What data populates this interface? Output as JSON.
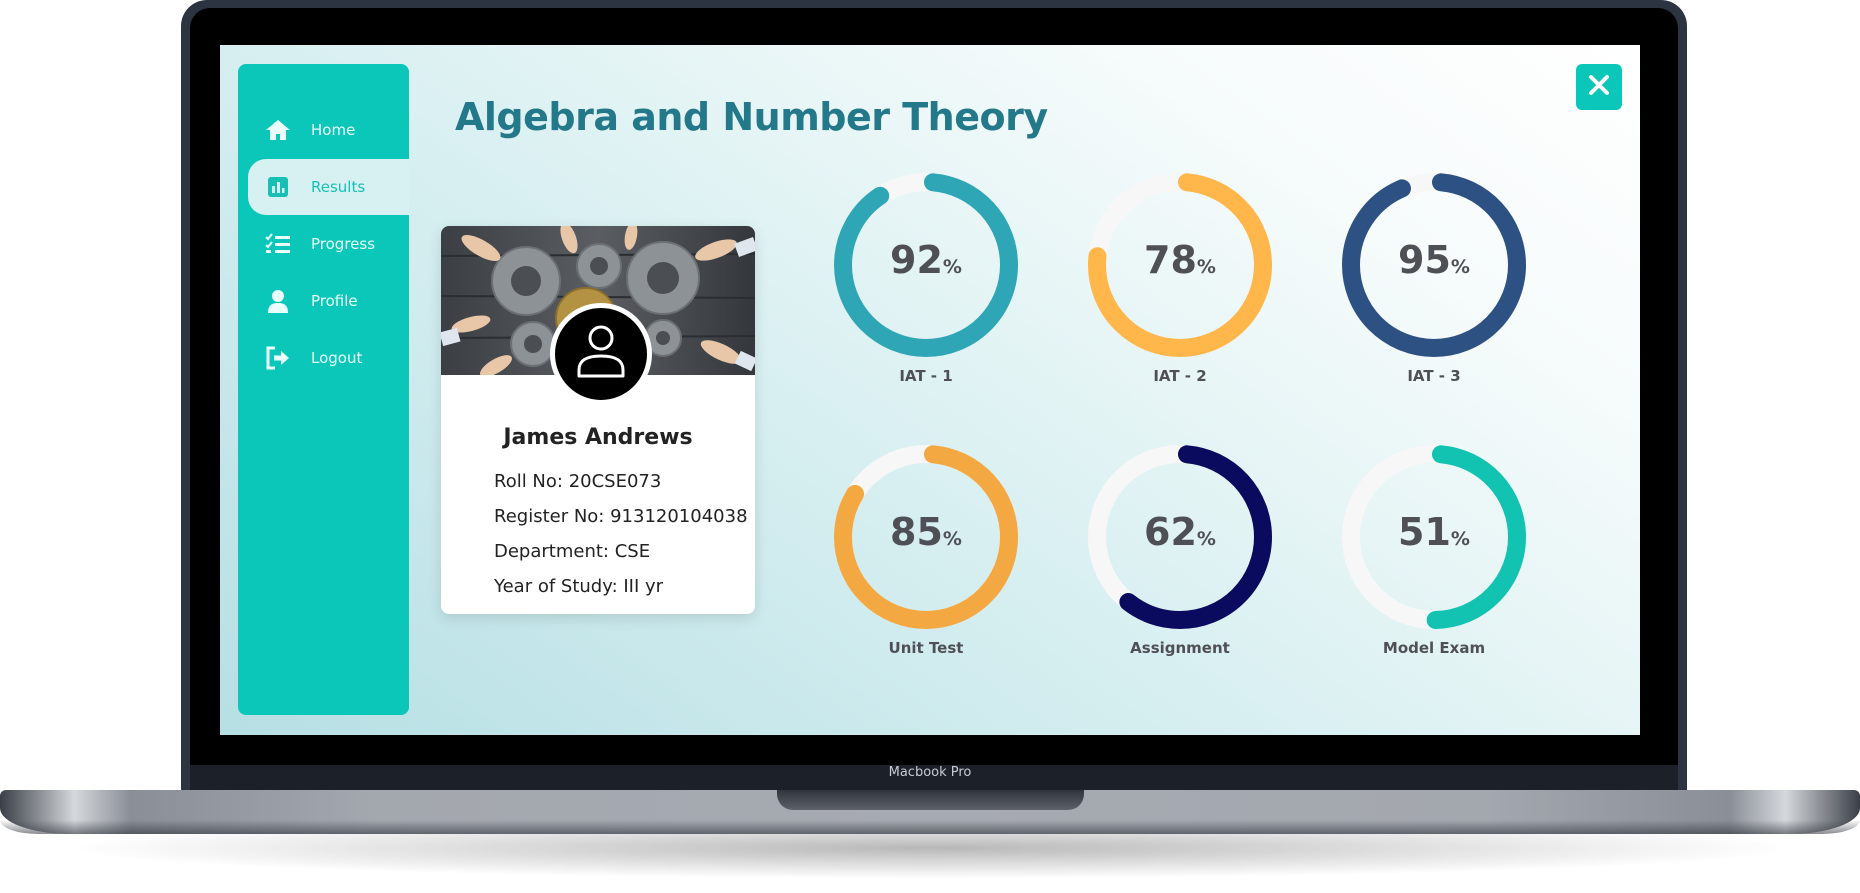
{
  "device": {
    "brand": "Macbook Pro"
  },
  "sidebar": {
    "items": [
      {
        "label": "Home",
        "icon": "home-icon"
      },
      {
        "label": "Results",
        "icon": "bar-chart-icon",
        "active": true
      },
      {
        "label": "Progress",
        "icon": "checklist-icon"
      },
      {
        "label": "Profile",
        "icon": "user-icon"
      },
      {
        "label": "Logout",
        "icon": "logout-icon"
      }
    ]
  },
  "page": {
    "title": "Algebra and Number Theory"
  },
  "profile": {
    "name": "James Andrews",
    "roll": "Roll No: 20CSE073",
    "register": "Register No: 913120104038",
    "department": "Department: CSE",
    "year": "Year of Study: III yr"
  },
  "scores": [
    {
      "label": "IAT - 1",
      "value": 92,
      "display": "92",
      "unit": "%",
      "color": "#2fa6b6"
    },
    {
      "label": "IAT - 2",
      "value": 78,
      "display": "78",
      "unit": "%",
      "color": "#ffb64a"
    },
    {
      "label": "IAT - 3",
      "value": 95,
      "display": "95",
      "unit": "%",
      "color": "#2d5182"
    },
    {
      "label": "Unit Test",
      "value": 85,
      "display": "85",
      "unit": "%",
      "color": "#f4a842"
    },
    {
      "label": "Assignment",
      "value": 62,
      "display": "62",
      "unit": "%",
      "color": "#0a0a5e"
    },
    {
      "label": "Model Exam",
      "value": 51,
      "display": "51",
      "unit": "%",
      "color": "#13c3b2"
    }
  ],
  "colors": {
    "accent": "#0bc7b9",
    "title": "#23788a",
    "track": "#f7f7f8"
  }
}
